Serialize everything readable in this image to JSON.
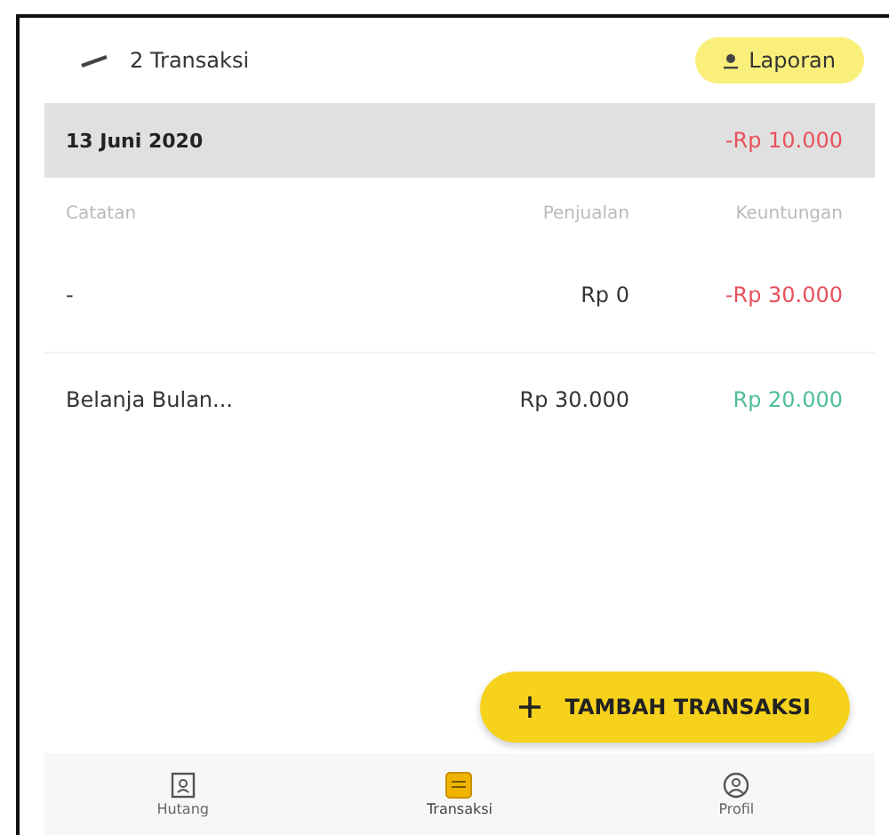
{
  "header": {
    "count_label": "2 Transaksi",
    "report_button": "Laporan"
  },
  "date_group": {
    "date": "13 Juni 2020",
    "total": "-Rp 10.000",
    "color": "#e8505b"
  },
  "table": {
    "columns": [
      "Catatan",
      "Penjualan",
      "Keuntungan"
    ],
    "rows": [
      {
        "note": "-",
        "sales": "Rp 0",
        "profit": "-Rp 30.000",
        "color": "#e8505b"
      },
      {
        "note": "Belanja Bulan...",
        "sales": "Rp 30.000",
        "profit": "Rp 20.000",
        "color": "#4dbf98"
      }
    ]
  },
  "fab": {
    "label": "TAMBAH TRANSAKSI"
  },
  "bottom_nav": [
    {
      "label": "Hutang",
      "selected": false
    },
    {
      "label": "Transaksi",
      "selected": true
    },
    {
      "label": "Profil",
      "selected": false
    }
  ]
}
